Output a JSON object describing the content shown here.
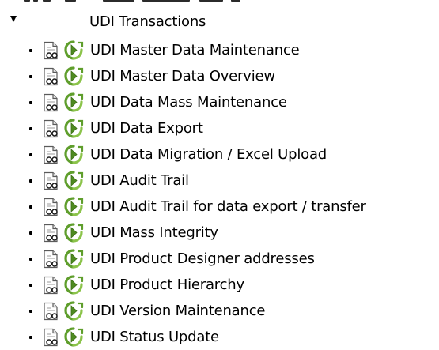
{
  "folder": {
    "label": "UDI Transactions",
    "expanded": true,
    "expander_icon": "triangle-down-icon"
  },
  "item_icons": {
    "document": "document-glasses-icon",
    "execute": "execute-transaction-icon",
    "execute_color": "#5f9e2c"
  },
  "items": [
    {
      "label": "UDI Master Data Maintenance"
    },
    {
      "label": "UDI Master Data Overview"
    },
    {
      "label": "UDI Data Mass Maintenance"
    },
    {
      "label": "UDI Data Export"
    },
    {
      "label": "UDI Data Migration / Excel Upload"
    },
    {
      "label": "UDI Audit Trail"
    },
    {
      "label": "UDI Audit Trail for data export / transfer"
    },
    {
      "label": "UDI Mass Integrity"
    },
    {
      "label": "UDI Product Designer addresses"
    },
    {
      "label": "UDI Product Hierarchy"
    },
    {
      "label": "UDI Version Maintenance"
    },
    {
      "label": "UDI Status Update"
    }
  ]
}
